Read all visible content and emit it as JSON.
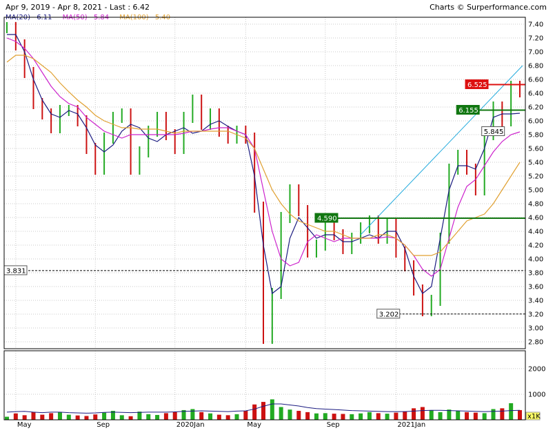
{
  "header": {
    "range": "Apr 9, 2019 - Apr 8, 2021 - Last : 6.42",
    "credit": "Charts © Surperformance.com"
  },
  "legend": [
    {
      "label": "MA(20)",
      "value": "6.11",
      "color": "#1a1a80"
    },
    {
      "label": "MA(50)",
      "value": "5.84",
      "color": "#cc22cc"
    },
    {
      "label": "MA(100)",
      "value": "5.40",
      "color": "#e0a030"
    }
  ],
  "colors": {
    "up": "#22aa22",
    "down": "#cc1111",
    "grid": "#c8c8c8",
    "trendline": "#22aadd",
    "volume_ma": "#1a1a80",
    "level_red": "#dd1111",
    "level_green": "#117711"
  },
  "chart_data": {
    "type": "line",
    "title": "",
    "x_tick_labels": [
      "May",
      "Sep",
      "2020Jan",
      "May",
      "Sep",
      "2021Jan"
    ],
    "price_axis": {
      "ylim": [
        2.7,
        7.5
      ],
      "ticks": [
        "7.40",
        "7.20",
        "7.00",
        "6.80",
        "6.60",
        "6.40",
        "6.20",
        "6.00",
        "5.80",
        "5.60",
        "5.40",
        "5.20",
        "5.00",
        "4.80",
        "4.60",
        "4.40",
        "4.20",
        "4.00",
        "3.80",
        "3.60",
        "3.40",
        "3.20",
        "3.00",
        "2.80"
      ],
      "tick_values": [
        7.4,
        7.2,
        7.0,
        6.8,
        6.6,
        6.4,
        6.2,
        6.0,
        5.8,
        5.6,
        5.4,
        5.2,
        5.0,
        4.8,
        4.6,
        4.4,
        4.2,
        4.0,
        3.8,
        3.6,
        3.4,
        3.2,
        3.0,
        2.8
      ]
    },
    "volume_axis": {
      "ylim": [
        0,
        2700
      ],
      "ticks": [
        "2000",
        "1000"
      ],
      "tick_values": [
        2000,
        1000
      ],
      "unit_label": "x1K"
    },
    "levels": [
      {
        "label": "6.525",
        "value": 6.525,
        "color": "red",
        "style": "solid"
      },
      {
        "label": "6.155",
        "value": 6.155,
        "color": "green",
        "style": "solid"
      },
      {
        "label": "5.845",
        "value": 5.845,
        "color": "black",
        "style": "none"
      },
      {
        "label": "4.590",
        "value": 4.59,
        "color": "green",
        "style": "solid"
      },
      {
        "label": "3.831",
        "value": 3.831,
        "color": "black",
        "style": "dashed"
      },
      {
        "label": "3.202",
        "value": 3.202,
        "color": "black",
        "style": "dashed"
      }
    ],
    "series": [
      {
        "name": "MA(20)",
        "color": "#1a1a80",
        "values": [
          7.25,
          7.25,
          7.0,
          6.6,
          6.3,
          6.1,
          6.05,
          6.15,
          6.1,
          5.9,
          5.65,
          5.55,
          5.65,
          5.85,
          5.95,
          5.9,
          5.75,
          5.7,
          5.8,
          5.85,
          5.9,
          5.82,
          5.85,
          5.95,
          6.0,
          5.92,
          5.85,
          5.8,
          5.2,
          4.2,
          3.5,
          3.6,
          4.3,
          4.6,
          4.45,
          4.3,
          4.35,
          4.35,
          4.25,
          4.25,
          4.3,
          4.35,
          4.3,
          4.4,
          4.4,
          4.15,
          3.75,
          3.5,
          3.6,
          4.3,
          5.0,
          5.35,
          5.35,
          5.3,
          5.6,
          6.05,
          6.1,
          6.1,
          6.11
        ]
      },
      {
        "name": "MA(50)",
        "color": "#cc22cc",
        "values": [
          7.2,
          7.15,
          7.05,
          6.9,
          6.7,
          6.5,
          6.35,
          6.25,
          6.2,
          6.05,
          5.95,
          5.85,
          5.8,
          5.75,
          5.8,
          5.8,
          5.8,
          5.8,
          5.8,
          5.8,
          5.82,
          5.85,
          5.85,
          5.88,
          5.9,
          5.9,
          5.85,
          5.8,
          5.6,
          5.0,
          4.4,
          4.0,
          3.9,
          3.95,
          4.25,
          4.35,
          4.3,
          4.25,
          4.3,
          4.3,
          4.3,
          4.3,
          4.3,
          4.32,
          4.3,
          4.2,
          4.05,
          3.85,
          3.75,
          3.85,
          4.3,
          4.75,
          5.05,
          5.15,
          5.35,
          5.55,
          5.7,
          5.8,
          5.84
        ]
      },
      {
        "name": "MA(100)",
        "color": "#e0a030",
        "values": [
          6.85,
          6.95,
          6.95,
          6.9,
          6.8,
          6.7,
          6.55,
          6.42,
          6.3,
          6.2,
          6.08,
          6.0,
          5.95,
          5.9,
          5.9,
          5.88,
          5.88,
          5.88,
          5.85,
          5.82,
          5.85,
          5.85,
          5.85,
          5.85,
          5.85,
          5.85,
          5.8,
          5.75,
          5.6,
          5.3,
          5.0,
          4.8,
          4.65,
          4.55,
          4.5,
          4.45,
          4.4,
          4.4,
          4.35,
          4.3,
          4.3,
          4.3,
          4.35,
          4.35,
          4.3,
          4.2,
          4.05,
          4.05,
          4.05,
          4.1,
          4.25,
          4.4,
          4.55,
          4.6,
          4.65,
          4.8,
          5.0,
          5.2,
          5.4
        ]
      },
      {
        "name": "Price",
        "color": "#000000",
        "values": [
          7.35,
          7.1,
          6.7,
          6.25,
          6.1,
          5.9,
          6.15,
          6.15,
          6.0,
          5.6,
          5.3,
          5.75,
          6.05,
          6.1,
          5.3,
          5.55,
          5.85,
          6.05,
          5.8,
          5.6,
          6.05,
          6.3,
          5.95,
          6.1,
          5.85,
          5.75,
          5.85,
          5.75,
          4.75,
          2.85,
          3.5,
          4.6,
          5.0,
          4.7,
          4.1,
          4.2,
          4.5,
          4.35,
          4.15,
          4.3,
          4.45,
          4.55,
          4.3,
          4.5,
          4.1,
          3.9,
          3.55,
          3.25,
          3.4,
          4.3,
          5.3,
          5.5,
          5.3,
          5.0,
          5.8,
          6.2,
          6.0,
          6.5,
          6.42
        ]
      }
    ],
    "volume": [
      120,
      250,
      180,
      300,
      200,
      260,
      310,
      200,
      170,
      150,
      210,
      280,
      350,
      180,
      140,
      320,
      220,
      190,
      260,
      300,
      380,
      420,
      300,
      250,
      200,
      180,
      220,
      350,
      600,
      700,
      800,
      500,
      400,
      350,
      300,
      250,
      260,
      240,
      230,
      220,
      250,
      300,
      260,
      240,
      280,
      330,
      450,
      500,
      380,
      300,
      400,
      350,
      300,
      280,
      260,
      420,
      450,
      650,
      380
    ],
    "volume_ma": [
      300,
      320,
      330,
      300,
      280,
      300,
      300,
      280,
      270,
      260,
      270,
      290,
      300,
      290,
      280,
      290,
      300,
      300,
      300,
      310,
      330,
      340,
      350,
      340,
      330,
      320,
      340,
      350,
      420,
      530,
      620,
      620,
      580,
      540,
      480,
      440,
      420,
      400,
      380,
      360,
      350,
      340,
      330,
      320,
      320,
      320,
      340,
      360,
      370,
      370,
      360,
      350,
      340,
      330,
      320,
      330,
      340,
      360,
      370
    ]
  }
}
